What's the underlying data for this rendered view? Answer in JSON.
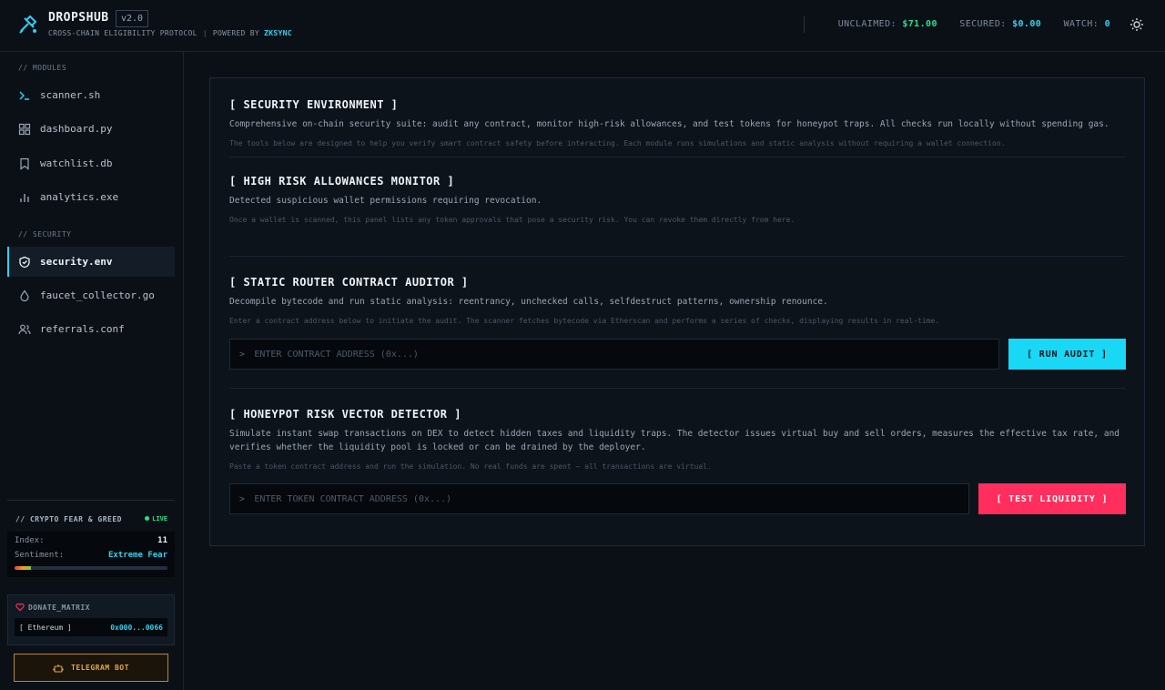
{
  "header": {
    "brand": "DROPSHUB",
    "version": "v2.0",
    "tagline": "CROSS-CHAIN ELIGIBILITY PROTOCOL",
    "separator": "|",
    "powered_by": "POWERED BY",
    "powered_brand": "ZKSYNC",
    "stats": {
      "unclaimed_label": "UNCLAIMED:",
      "unclaimed_value": "$71.00",
      "secured_label": "SECURED:",
      "secured_value": "$0.00",
      "watch_label": "WATCH:",
      "watch_value": "0"
    }
  },
  "sidebar": {
    "modules_label": "// MODULES",
    "modules": [
      {
        "label": "scanner.sh",
        "icon": "terminal-icon"
      },
      {
        "label": "dashboard.py",
        "icon": "grid-icon"
      },
      {
        "label": "watchlist.db",
        "icon": "bookmark-icon"
      },
      {
        "label": "analytics.exe",
        "icon": "bar-chart-icon"
      }
    ],
    "security_label": "// SECURITY",
    "security": [
      {
        "label": "security.env",
        "icon": "shield-icon",
        "active": true
      },
      {
        "label": "faucet_collector.go",
        "icon": "droplet-icon"
      },
      {
        "label": "referrals.conf",
        "icon": "users-icon"
      }
    ],
    "fear_greed": {
      "title": "// CRYPTO FEAR & GREED",
      "live": "LIVE",
      "index_label": "Index:",
      "index_value": "11",
      "sentiment_label": "Sentiment:",
      "sentiment_value": "Extreme Fear",
      "gauge_level": 0.11
    },
    "donate": {
      "title": "DONATE_MATRIX",
      "network": "[ Ethereum ]",
      "address": "0x000...0066"
    },
    "telegram_label": "TELEGRAM BOT"
  },
  "main": {
    "env": {
      "title": "[ SECURITY ENVIRONMENT ]",
      "desc": "Comprehensive on-chain security suite: audit any contract, monitor high-risk allowances, and test tokens for honeypot traps. All checks run locally without spending gas.",
      "note": "The tools below are designed to help you verify smart contract safety before interacting. Each module runs simulations and static analysis without requiring a wallet connection."
    },
    "allowances": {
      "title": "[ HIGH RISK ALLOWANCES MONITOR ]",
      "desc": "Detected suspicious wallet permissions requiring revocation.",
      "note": "Once a wallet is scanned, this panel lists any token approvals that pose a security risk. You can revoke them directly from here."
    },
    "auditor": {
      "title": "[ STATIC ROUTER CONTRACT AUDITOR ]",
      "desc": "Decompile bytecode and run static analysis: reentrancy, unchecked calls, selfdestruct patterns, ownership renounce.",
      "note": "Enter a contract address below to initiate the audit. The scanner fetches bytecode via Etherscan and performs a series of checks, displaying results in real-time.",
      "prompt": ">",
      "placeholder": "ENTER CONTRACT ADDRESS (0x...)",
      "button": "[ RUN AUDIT ]"
    },
    "honeypot": {
      "title": "[ HONEYPOT RISK VECTOR DETECTOR ]",
      "desc": "Simulate instant swap transactions on DEX to detect hidden taxes and liquidity traps. The detector issues virtual buy and sell orders, measures the effective tax rate, and verifies whether the liquidity pool is locked or can be drained by the deployer.",
      "note": "Paste a token contract address and run the simulation. No real funds are spent — all transactions are virtual.",
      "prompt": ">",
      "placeholder": "ENTER TOKEN CONTRACT ADDRESS (0x...)",
      "button": "[ TEST LIQUIDITY ]"
    }
  },
  "colors": {
    "accent": "#18d8f5",
    "danger": "#ff2e5d",
    "success": "#22e38a",
    "warning": "#e7a83b"
  }
}
